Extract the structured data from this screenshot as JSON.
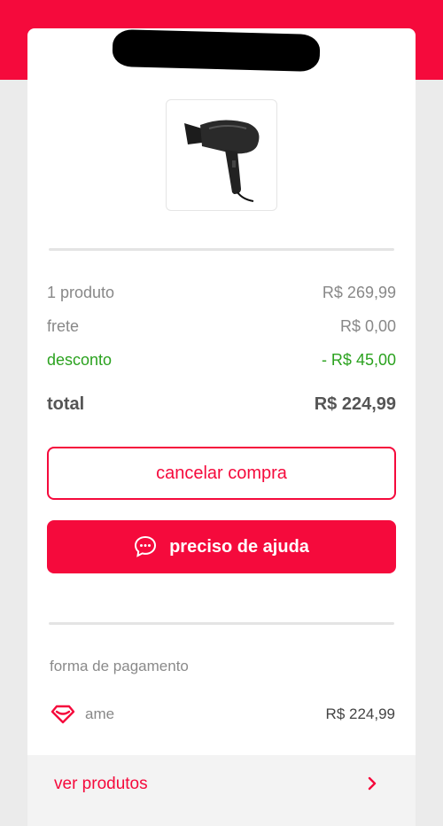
{
  "order": {
    "product_image_alt": "hair dryer",
    "summary": {
      "products_label": "1 produto",
      "products_value": "R$ 269,99",
      "shipping_label": "frete",
      "shipping_value": "R$ 0,00",
      "discount_label": "desconto",
      "discount_value": "- R$ 45,00",
      "total_label": "total",
      "total_value": "R$ 224,99"
    },
    "actions": {
      "cancel_label": "cancelar compra",
      "help_label": "preciso de ajuda"
    },
    "payment": {
      "section_title": "forma de pagamento",
      "method_name": "ame",
      "method_amount": "R$ 224,99"
    },
    "footer": {
      "link_label": "ver produtos"
    }
  },
  "colors": {
    "brand": "#f50a3c",
    "discount": "#2ba21f",
    "background": "#ebebeb"
  },
  "icons": {
    "help_icon": "chat-bubble-icon",
    "payment_icon": "ame-heart-icon",
    "footer_icon": "chevron-right-icon"
  }
}
